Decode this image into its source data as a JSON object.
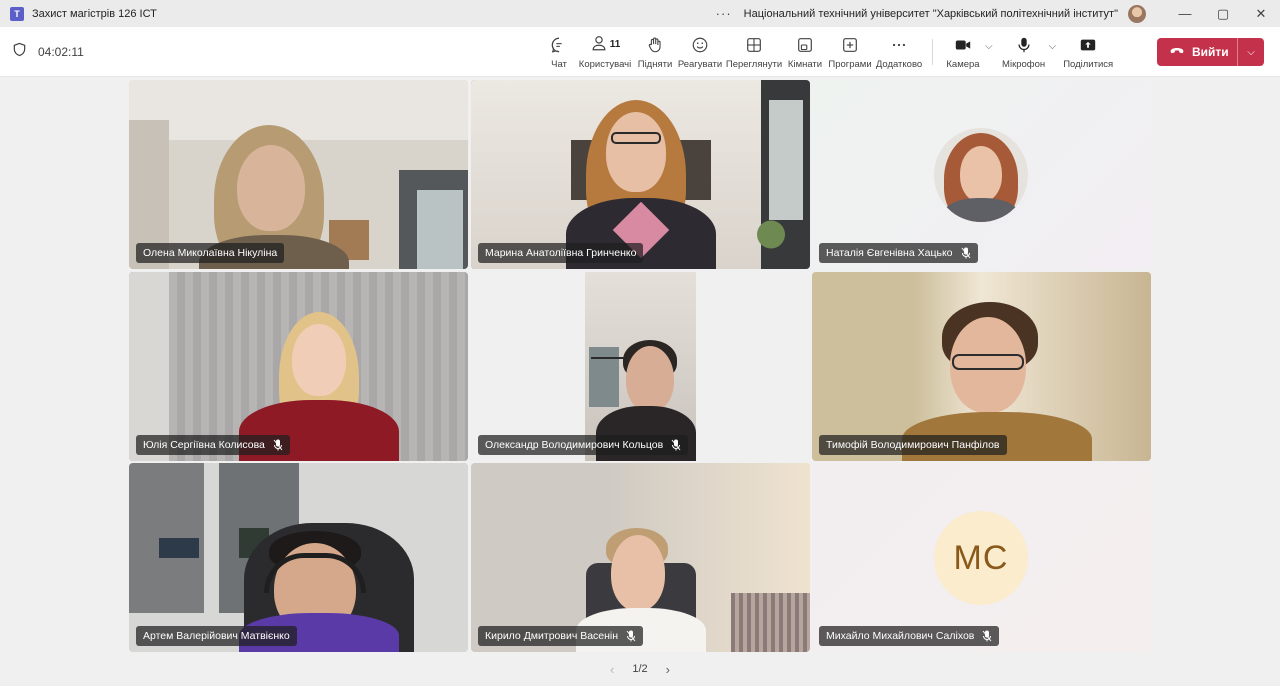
{
  "window": {
    "title": "Захист магістрів 126 ІСТ",
    "organization": "Національний технічний університет \"Харківський політехнічний інститут\"",
    "more": "···",
    "controls": {
      "minimize": "—",
      "restore": "▢",
      "close": "✕"
    }
  },
  "toolbar": {
    "timer": "04:02:11",
    "buttons": {
      "chat": "Чат",
      "people": "Користувачі",
      "people_count": "11",
      "raise": "Підняти",
      "react": "Реагувати",
      "view": "Переглянути",
      "rooms": "Кімнати",
      "apps": "Програми",
      "more": "Додатково",
      "camera": "Камера",
      "mic": "Мікрофон",
      "share": "Поділитися"
    },
    "leave": "Вийти",
    "leave_color": "#c4314b"
  },
  "participants": [
    {
      "name": "Олена Миколаївна Нікуліна",
      "muted": false
    },
    {
      "name": "Марина Анатоліївна Гринченко",
      "muted": false,
      "speaking": true
    },
    {
      "name": "Наталія Євгенівна Хацько",
      "muted": true
    },
    {
      "name": "Юлія Сергіївна Колисова",
      "muted": true
    },
    {
      "name": "Олександр Володимирович Кольцов",
      "muted": true
    },
    {
      "name": "Тимофій Володимирович Панфілов",
      "muted": false
    },
    {
      "name": "Артем Валерійович Матвієнко",
      "muted": false
    },
    {
      "name": "Кирило Дмитрович Васенін",
      "muted": true
    },
    {
      "name": "Михайло Михайлович Саліхов",
      "muted": true,
      "initials": "МС"
    }
  ],
  "pager": {
    "prev": "‹",
    "label": "1/2",
    "next": "›"
  },
  "colors": {
    "accent": "#6264a7",
    "leave": "#c4314b",
    "initials_bg": "#fbecce",
    "initials_text": "#8a5a1a"
  }
}
